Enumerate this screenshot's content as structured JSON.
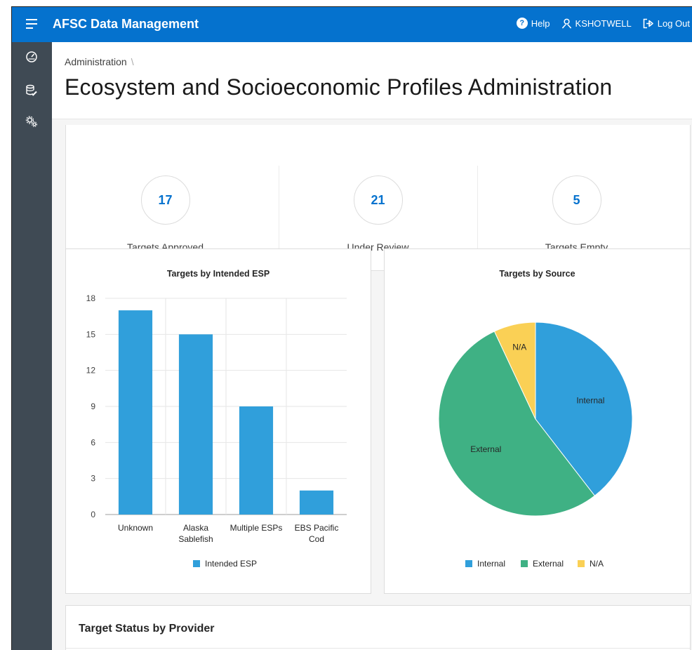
{
  "app": {
    "title": "AFSC Data Management",
    "nav": {
      "help": "Help",
      "user": "KSHOTWELL",
      "logout": "Log Out"
    }
  },
  "sidebar": {
    "items": [
      {
        "icon": "dashboard-gauge-icon"
      },
      {
        "icon": "database-edit-icon"
      },
      {
        "icon": "gears-icon"
      }
    ]
  },
  "page": {
    "breadcrumb": "Administration",
    "breadcrumb_separator": "\\",
    "title": "Ecosystem and Socioeconomic Profiles Administration"
  },
  "stats": [
    {
      "value": "17",
      "label": "Targets Approved"
    },
    {
      "value": "21",
      "label": "Under Review"
    },
    {
      "value": "5",
      "label": "Targets Empty"
    }
  ],
  "colors": {
    "brand": "#0572ce",
    "sidebar": "#3f4a54",
    "bar": "#309fdb",
    "internal": "#309fdb",
    "external": "#3fb184",
    "na": "#fad055"
  },
  "chart_data": [
    {
      "type": "bar",
      "title": "Targets by Intended ESP",
      "categories": [
        "Unknown",
        "Alaska Sablefish",
        "Multiple ESPs",
        "EBS Pacific Cod"
      ],
      "category_lines": [
        [
          "Unknown"
        ],
        [
          "Alaska",
          "Sablefish"
        ],
        [
          "Multiple ESPs"
        ],
        [
          "EBS Pacific",
          "Cod"
        ]
      ],
      "series": [
        {
          "name": "Intended ESP",
          "values": [
            17,
            15,
            9,
            2
          ]
        }
      ],
      "yticks": [
        0,
        3,
        6,
        9,
        12,
        15,
        18
      ],
      "ylim": [
        0,
        18
      ],
      "grid": true,
      "legend": "bottom"
    },
    {
      "type": "pie",
      "title": "Targets by Source",
      "labels": [
        "Internal",
        "External",
        "N/A"
      ],
      "values": [
        17,
        23,
        3
      ],
      "legend": "bottom"
    }
  ],
  "provider_panel": {
    "title": "Target Status by Provider"
  }
}
